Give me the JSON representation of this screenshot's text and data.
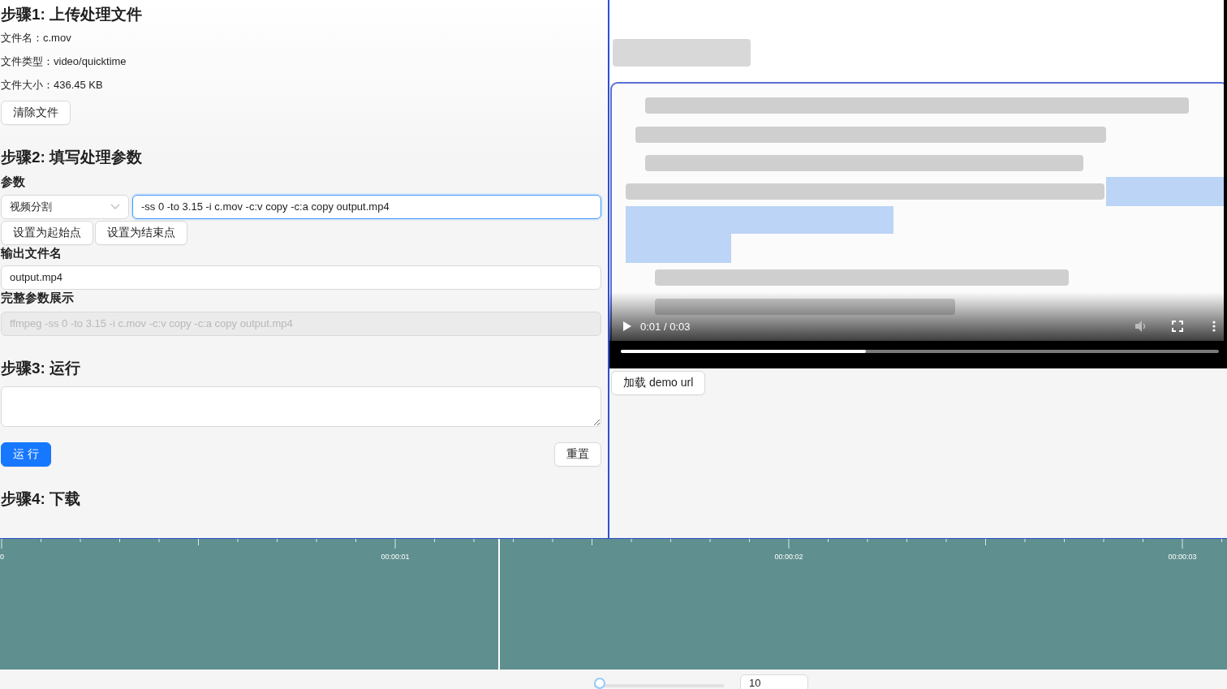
{
  "step1": {
    "title": "步骤1: 上传处理文件",
    "info": [
      "文件名：c.mov",
      "文件类型：video/quicktime",
      "文件大小：436.45 KB"
    ],
    "clear_button": "清除文件"
  },
  "step2": {
    "title": "步骤2: 填写处理参数",
    "params_label": "参数",
    "mode_select": "视频分割",
    "params_value": "-ss 0 -to 3.15 -i c.mov -c:v copy -c:a copy output.mp4",
    "point_buttons": [
      "设置为起始点",
      "设置为结束点"
    ],
    "output_label": "输出文件名",
    "output_value": "output.mp4",
    "full_label": "完整参数展示",
    "full": {
      "value": "ffmpeg -ss 0 -to 3.15 -i c.mov -c:v copy -c:a copy output.mp4",
      "disabled": true
    }
  },
  "step3": {
    "title": "步骤3: 运行",
    "run_button": "运 行",
    "reset_button": "重置"
  },
  "step4": {
    "title": "步骤4: 下载"
  },
  "player": {
    "kind": "picture",
    "time": "0:01 / 0:03",
    "level": 0.41,
    "load_button": "加载 demo url"
  },
  "timeline": {
    "ticks": [
      "0",
      "00:00:01",
      "00:00:02",
      "00:00:03"
    ],
    "level": 0.406
  },
  "zoom": {
    "level": 0,
    "value": "10"
  }
}
